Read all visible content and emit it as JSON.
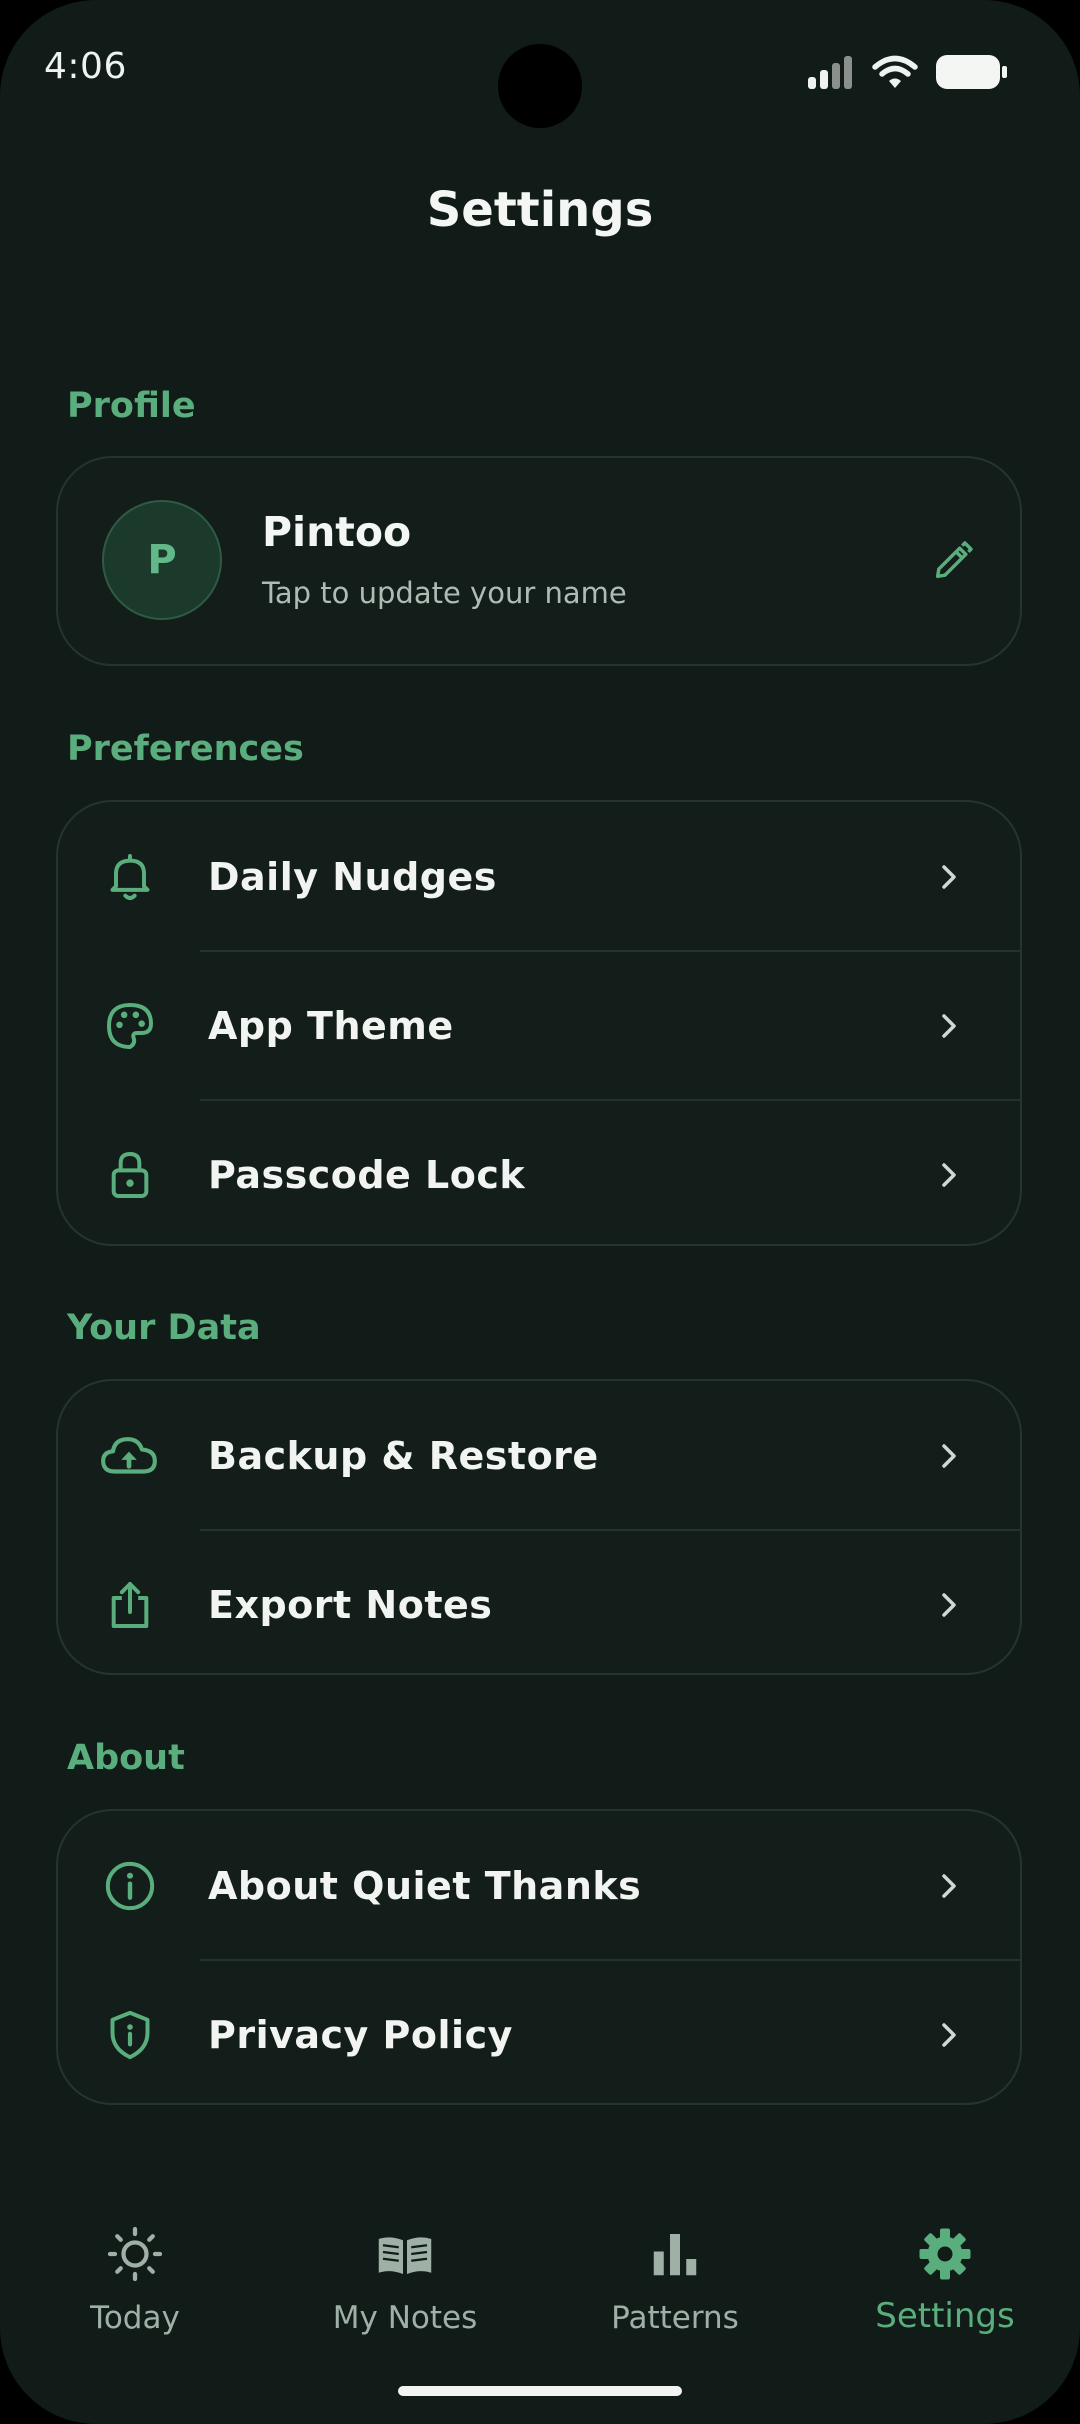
{
  "status_bar": {
    "time": "4:06"
  },
  "header": {
    "title": "Settings"
  },
  "sections": {
    "profile": "Profile",
    "preferences": "Preferences",
    "your_data": "Your Data",
    "about": "About"
  },
  "profile": {
    "initial": "P",
    "name": "Pintoo",
    "subtitle": "Tap to update your name"
  },
  "preferences": [
    {
      "label": "Daily Nudges",
      "icon": "bell-icon"
    },
    {
      "label": "App Theme",
      "icon": "palette-icon"
    },
    {
      "label": "Passcode Lock",
      "icon": "lock-icon"
    }
  ],
  "your_data": [
    {
      "label": "Backup & Restore",
      "icon": "cloud-upload-icon"
    },
    {
      "label": "Export Notes",
      "icon": "share-icon"
    }
  ],
  "about": [
    {
      "label": "About Quiet Thanks",
      "icon": "info-icon"
    },
    {
      "label": "Privacy Policy",
      "icon": "shield-icon"
    }
  ],
  "bottom_nav": [
    {
      "label": "Today",
      "icon": "sun-icon",
      "active": false
    },
    {
      "label": "My Notes",
      "icon": "book-icon",
      "active": false
    },
    {
      "label": "Patterns",
      "icon": "bar-chart-icon",
      "active": false
    },
    {
      "label": "Settings",
      "icon": "gear-icon",
      "active": true
    }
  ],
  "colors": {
    "background": "#111b17",
    "accent": "#5aae7d",
    "text": "#f1f4f1",
    "muted": "#9fb1a7"
  }
}
